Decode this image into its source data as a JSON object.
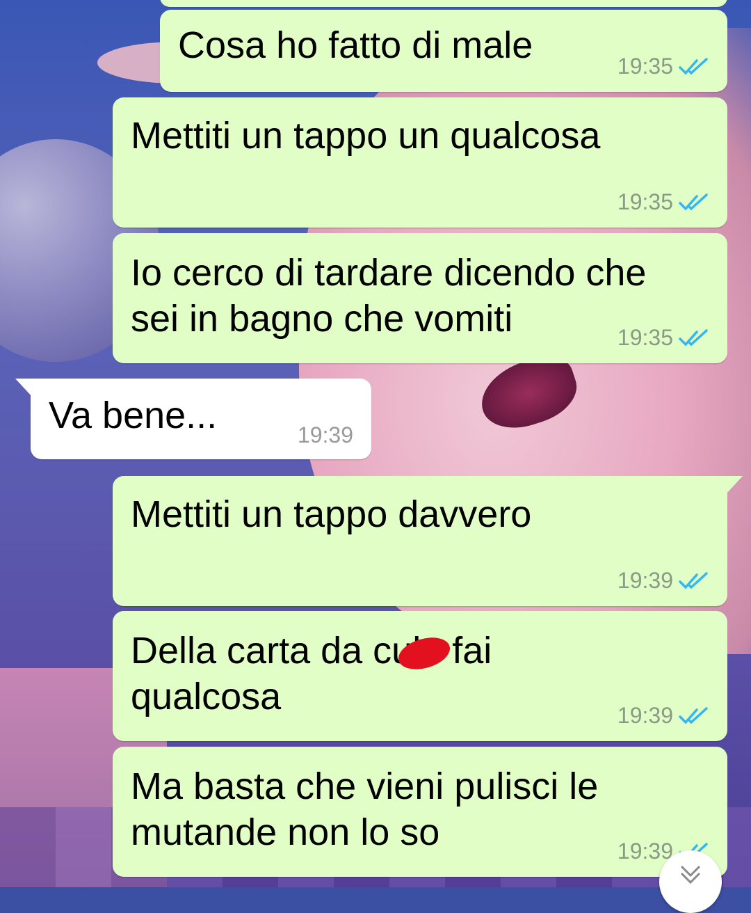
{
  "messages": [
    {
      "direction": "out",
      "text": "Cosa ho fatto di male",
      "time": "19:35",
      "status_icon": "double-check-read"
    },
    {
      "direction": "out",
      "text": "Mettiti un tappo un qualcosa",
      "time": "19:35",
      "status_icon": "double-check-read"
    },
    {
      "direction": "out",
      "text": "Io cerco di tardare dicendo che\nsei in bagno che vomiti",
      "time": "19:35",
      "status_icon": "double-check-read"
    },
    {
      "direction": "in",
      "text": "Va bene...",
      "time": "19:39"
    },
    {
      "direction": "out",
      "text": "Mettiti un tappo davvero",
      "time": "19:39",
      "status_icon": "double-check-read"
    },
    {
      "direction": "out",
      "text": "Della carta da culo fai\nqualcosa",
      "time": "19:39",
      "status_icon": "double-check-read",
      "redaction_color": "#e3111f"
    },
    {
      "direction": "out",
      "text": "Ma basta che vieni pulisci le\nmutande non lo so",
      "time": "19:39",
      "status_icon": "double-check-read"
    }
  ],
  "colors": {
    "outgoing_bubble": "#e1fec6",
    "incoming_bubble": "#ffffff",
    "read_ticks": "#34b7f1",
    "timestamp": "#8a9a86"
  },
  "scroll_button_icon": "chevron-double-down-icon"
}
